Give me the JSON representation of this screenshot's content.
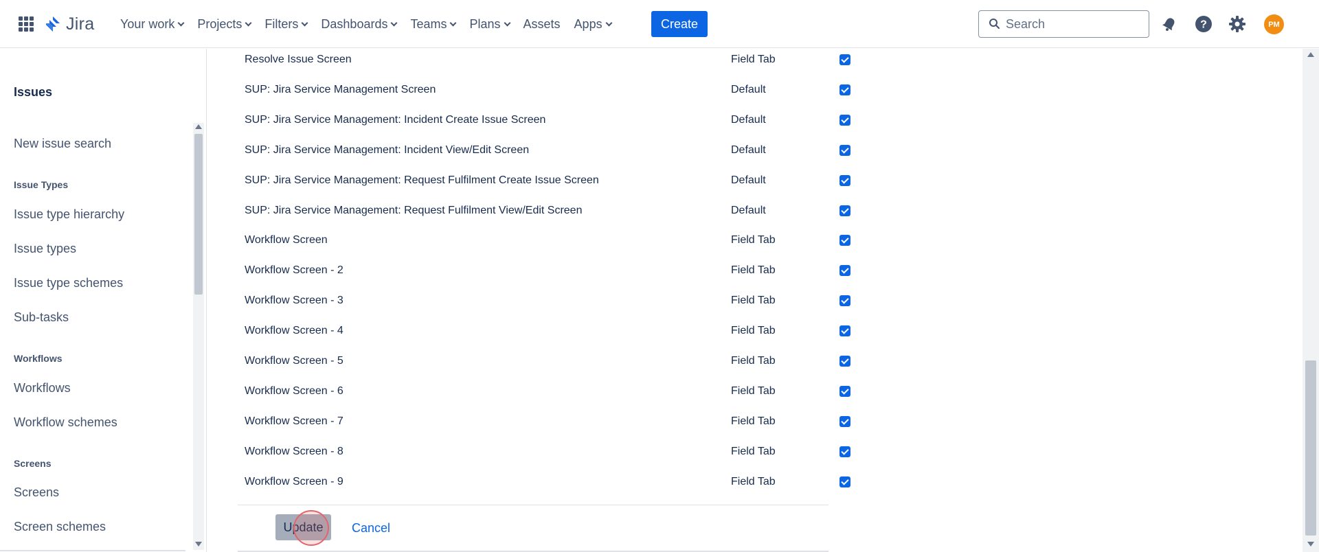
{
  "colors": {
    "accent": "#0c66e4",
    "avatar": "#f18d13",
    "click_marker": "#e2656b"
  },
  "topnav": {
    "apps_icon": "app-switcher-icon",
    "logo_icon": "jira-logo-icon",
    "logo_text": "Jira",
    "items": [
      {
        "label": "Your work",
        "dropdown": true
      },
      {
        "label": "Projects",
        "dropdown": true
      },
      {
        "label": "Filters",
        "dropdown": true
      },
      {
        "label": "Dashboards",
        "dropdown": true
      },
      {
        "label": "Teams",
        "dropdown": true
      },
      {
        "label": "Plans",
        "dropdown": true
      },
      {
        "label": "Assets",
        "dropdown": false
      },
      {
        "label": "Apps",
        "dropdown": true
      }
    ],
    "create_label": "Create",
    "search_placeholder": "Search",
    "icons": [
      "notifications-icon",
      "help-icon",
      "settings-icon"
    ],
    "avatar_initials": "PM"
  },
  "sidebar": {
    "heading": "Issues",
    "links": {
      "new_issue_search": "New issue search",
      "issue_type_hierarchy": "Issue type hierarchy",
      "issue_types": "Issue types",
      "issue_type_schemes": "Issue type schemes",
      "sub_tasks": "Sub-tasks",
      "workflows": "Workflows",
      "workflow_schemes": "Workflow schemes",
      "screens": "Screens",
      "screen_schemes": "Screen schemes"
    },
    "sections": {
      "issue_types": "Issue Types",
      "workflows": "Workflows",
      "screens": "Screens"
    }
  },
  "screens": [
    {
      "name": "Resolve Issue Screen",
      "tab": "Field Tab",
      "checked": true
    },
    {
      "name": "SUP: Jira Service Management Screen",
      "tab": "Default",
      "checked": true
    },
    {
      "name": "SUP: Jira Service Management: Incident Create Issue Screen",
      "tab": "Default",
      "checked": true
    },
    {
      "name": "SUP: Jira Service Management: Incident View/Edit Screen",
      "tab": "Default",
      "checked": true
    },
    {
      "name": "SUP: Jira Service Management: Request Fulfilment Create Issue Screen",
      "tab": "Default",
      "checked": true
    },
    {
      "name": "SUP: Jira Service Management: Request Fulfilment View/Edit Screen",
      "tab": "Default",
      "checked": true
    },
    {
      "name": "Workflow Screen",
      "tab": "Field Tab",
      "checked": true
    },
    {
      "name": "Workflow Screen - 2",
      "tab": "Field Tab",
      "checked": true
    },
    {
      "name": "Workflow Screen - 3",
      "tab": "Field Tab",
      "checked": true
    },
    {
      "name": "Workflow Screen - 4",
      "tab": "Field Tab",
      "checked": true
    },
    {
      "name": "Workflow Screen - 5",
      "tab": "Field Tab",
      "checked": true
    },
    {
      "name": "Workflow Screen - 6",
      "tab": "Field Tab",
      "checked": true
    },
    {
      "name": "Workflow Screen - 7",
      "tab": "Field Tab",
      "checked": true
    },
    {
      "name": "Workflow Screen - 8",
      "tab": "Field Tab",
      "checked": true
    },
    {
      "name": "Workflow Screen - 9",
      "tab": "Field Tab",
      "checked": true
    }
  ],
  "actions": {
    "update_label": "Update",
    "cancel_label": "Cancel"
  }
}
